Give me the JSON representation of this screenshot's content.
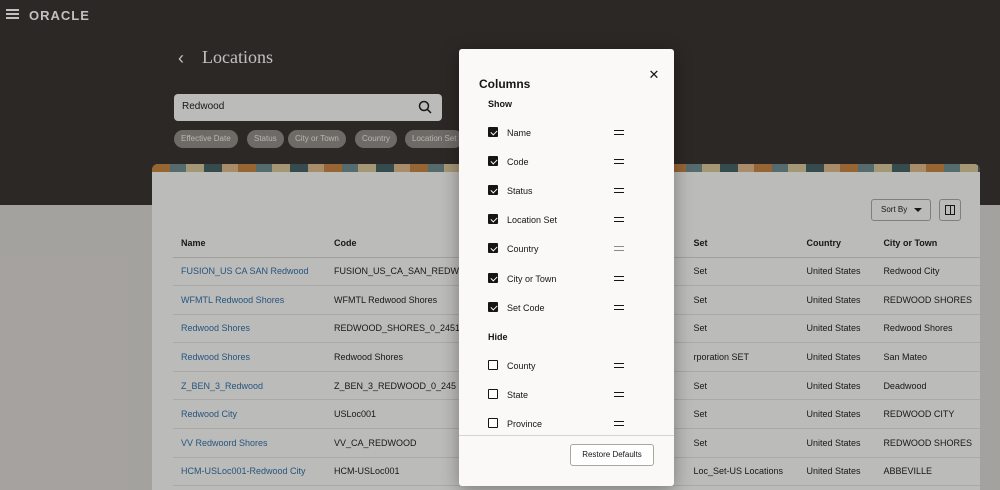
{
  "app": {
    "logo": "ORACLE",
    "back_glyph": "‹",
    "title": "Locations"
  },
  "search": {
    "value": "Redwood"
  },
  "filters": [
    "Effective Date",
    "Status",
    "City or Town",
    "Country",
    "Location Set"
  ],
  "toolbar": {
    "sort_label": "Sort By"
  },
  "table": {
    "columns": [
      "Name",
      "Code",
      "",
      "Set",
      "Country",
      "City or Town"
    ],
    "rows": [
      [
        "FUSION_US CA SAN Redwood",
        "FUSION_US_CA_SAN_REDWO",
        "",
        "Set",
        "United States",
        "Redwood City"
      ],
      [
        "WFMTL Redwood Shores",
        "WFMTL Redwood Shores",
        "",
        "Set",
        "United States",
        "REDWOOD SHORES"
      ],
      [
        "Redwood Shores",
        "REDWOOD_SHORES_0_2451",
        "",
        "Set",
        "United States",
        "Redwood Shores"
      ],
      [
        "Redwood Shores",
        "Redwood Shores",
        "",
        "rporation SET",
        "United States",
        "San Mateo"
      ],
      [
        "Z_BEN_3_Redwood",
        "Z_BEN_3_REDWOOD_0_245",
        "",
        "Set",
        "United States",
        "Deadwood"
      ],
      [
        "Redwood City",
        "USLoc001",
        "",
        "Set",
        "United States",
        "REDWOOD CITY"
      ],
      [
        "VV Redwoord Shores",
        "VV_CA_REDWOOD",
        "",
        "Set",
        "United States",
        "REDWOOD SHORES"
      ],
      [
        "HCM-USLoc001-Redwood City",
        "HCM-USLoc001",
        "",
        "Loc_Set-US Locations",
        "United States",
        "ABBEVILLE"
      ]
    ]
  },
  "dialog": {
    "title": "Columns",
    "close_glyph": "✕",
    "show_label": "Show",
    "hide_label": "Hide",
    "show_items": [
      "Name",
      "Code",
      "Status",
      "Location Set",
      "Country",
      "City or Town",
      "Set Code"
    ],
    "hide_items": [
      "County",
      "State",
      "Province"
    ],
    "restore_label": "Restore Defaults"
  },
  "colors": {
    "header_bg": "#312d2a",
    "link": "#2a6aa6",
    "chip_bg": "#8e8a86"
  }
}
